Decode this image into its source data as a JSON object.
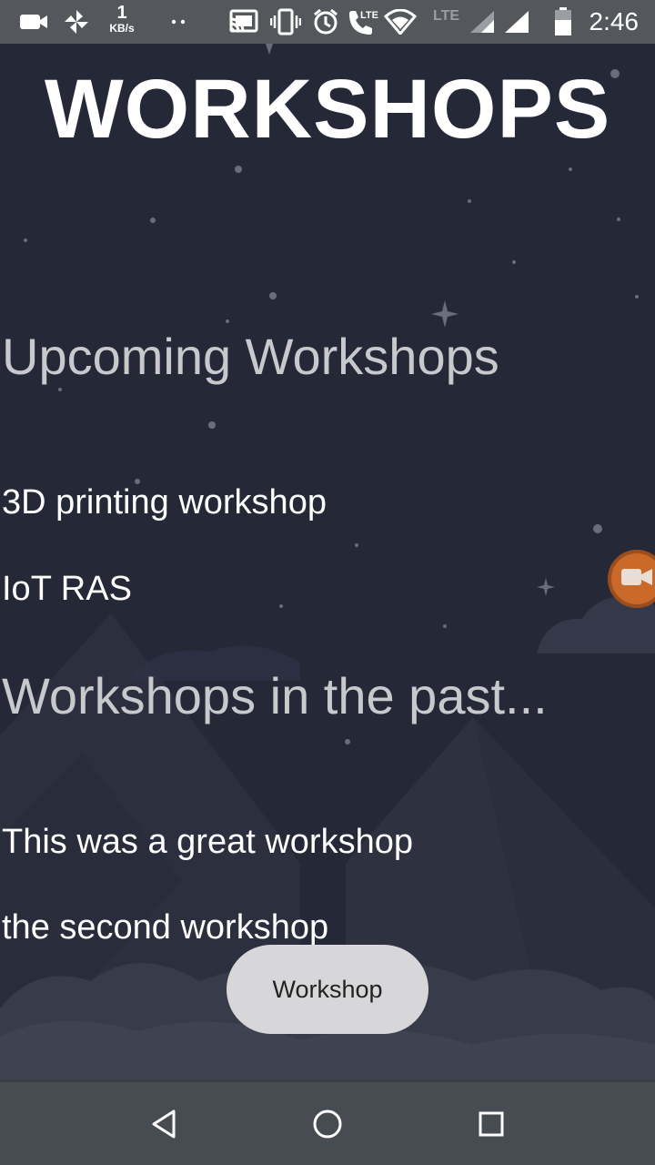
{
  "status_bar": {
    "net_speed_value": "1",
    "net_speed_unit": "KB/s",
    "lte_label": "LTE",
    "time": "2:46",
    "icons": [
      "video-camera-icon",
      "pinwheel-icon",
      "dots-icon",
      "cast-icon",
      "vibrate-icon",
      "alarm-icon",
      "volte-call-icon",
      "wifi-icon",
      "signal-icon",
      "signal-icon",
      "battery-icon"
    ]
  },
  "page": {
    "title": "WORKSHOPS"
  },
  "upcoming": {
    "heading": "Upcoming Workshops",
    "items": [
      "3D printing workshop",
      "IoT RAS"
    ]
  },
  "past": {
    "heading": "Workshops in the past...",
    "items": [
      "This was a great workshop",
      "the second workshop"
    ]
  },
  "overlay": {
    "camera_button_icon": "video-camera-icon",
    "chip_label": "Workshop"
  },
  "nav_bar": {
    "icons": [
      "back-icon",
      "home-icon",
      "recents-icon"
    ]
  },
  "colors": {
    "background": "#252836",
    "status_bar": "#54585c",
    "nav_bar": "#474b52",
    "heading_text": "#c8c9cc",
    "item_text": "#ffffff",
    "camera_button": "#c96a2a",
    "chip_background": "#d7d7d9"
  }
}
